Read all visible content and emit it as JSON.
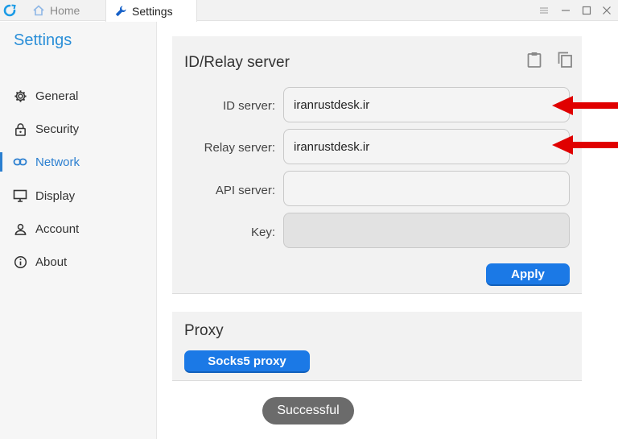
{
  "titlebar": {
    "tabs": [
      {
        "label": "Home",
        "icon": "home-icon"
      },
      {
        "label": "Settings",
        "icon": "wrench-icon"
      }
    ],
    "controls": [
      "menu-icon",
      "minimize-icon",
      "maximize-icon",
      "close-icon"
    ]
  },
  "sidebar": {
    "title": "Settings",
    "items": [
      {
        "label": "General",
        "icon": "gear-icon"
      },
      {
        "label": "Security",
        "icon": "lock-icon"
      },
      {
        "label": "Network",
        "icon": "link-icon",
        "active": true
      },
      {
        "label": "Display",
        "icon": "monitor-icon"
      },
      {
        "label": "Account",
        "icon": "person-icon"
      },
      {
        "label": "About",
        "icon": "info-icon"
      }
    ]
  },
  "id_relay": {
    "title": "ID/Relay server",
    "tools": [
      "clipboard-paste-icon",
      "copy-icon"
    ],
    "fields": [
      {
        "label": "ID server:",
        "value": "iranrustdesk.ir"
      },
      {
        "label": "Relay server:",
        "value": "iranrustdesk.ir"
      },
      {
        "label": "API server:",
        "value": ""
      },
      {
        "label": "Key:",
        "value": ""
      }
    ],
    "apply_label": "Apply"
  },
  "proxy": {
    "title": "Proxy",
    "socks_label": "Socks5 proxy"
  },
  "toast": "Successful",
  "colors": {
    "accent": "#1b79e6",
    "sidebar_title": "#2b8fd8",
    "annotation_arrow": "#e00000"
  }
}
